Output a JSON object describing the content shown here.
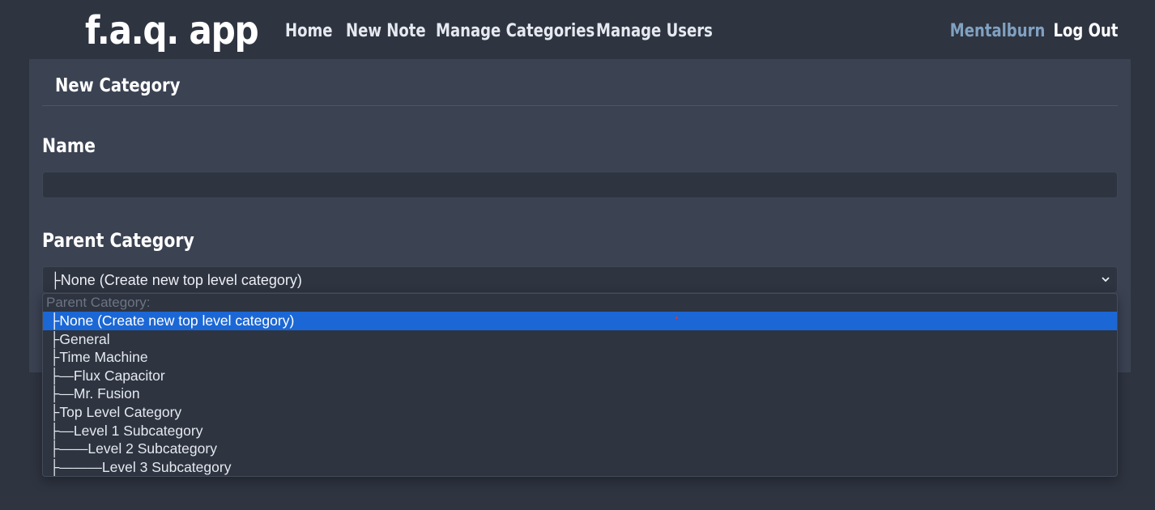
{
  "nav": {
    "brand": "f.a.q. app",
    "links": [
      {
        "label": "Home"
      },
      {
        "label": "New Note"
      },
      {
        "label": "Manage Categories"
      },
      {
        "label": "Manage Users"
      }
    ],
    "user": "Mentalburn",
    "logout": "Log Out"
  },
  "panel": {
    "title": "New Category"
  },
  "form": {
    "name_label": "Name",
    "name_value": "",
    "parent_label": "Parent Category",
    "parent_selected": "├None (Create new top level category)"
  },
  "dropdown": {
    "header": "Parent Category:",
    "options": [
      {
        "label": "├None (Create new top level category)",
        "selected": true
      },
      {
        "label": "├General",
        "selected": false
      },
      {
        "label": "├Time Machine",
        "selected": false
      },
      {
        "label": "├—Flux Capacitor",
        "selected": false
      },
      {
        "label": "├—Mr. Fusion",
        "selected": false
      },
      {
        "label": "├Top Level Category",
        "selected": false
      },
      {
        "label": "├—Level 1 Subcategory",
        "selected": false
      },
      {
        "label": "├——Level 2 Subcategory",
        "selected": false
      },
      {
        "label": "├———Level 3 Subcategory",
        "selected": false
      }
    ]
  },
  "colors": {
    "background": "#2e3440",
    "panel": "#3b4252",
    "accent_user": "#81a1c1",
    "selected_option": "#1b67d5"
  },
  "icons": {
    "select_arrow": "chevron-down-icon"
  }
}
